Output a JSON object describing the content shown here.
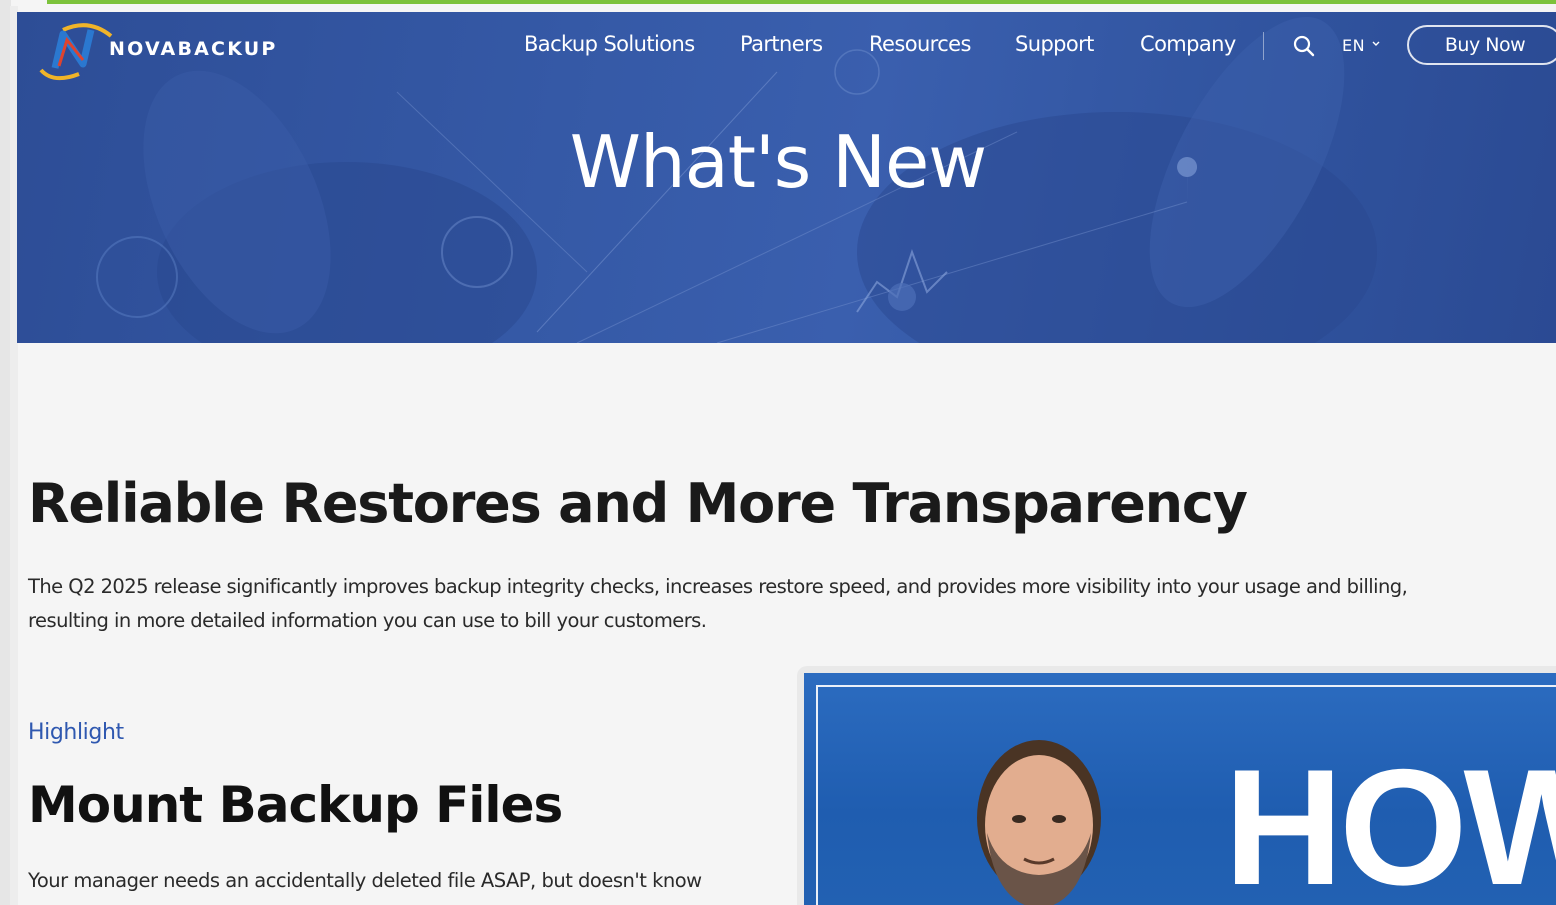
{
  "header": {
    "logo_text": "NOVABACKUP",
    "nav": [
      {
        "label": "Backup Solutions"
      },
      {
        "label": "Partners"
      },
      {
        "label": "Resources"
      },
      {
        "label": "Support"
      },
      {
        "label": "Company"
      }
    ],
    "search_icon": "search-icon",
    "language": "EN",
    "buy_now_label": "Buy Now"
  },
  "hero": {
    "title": "What's New"
  },
  "main": {
    "heading": "Reliable Restores and More Transparency",
    "intro_line1": "The Q2 2025 release significantly improves backup integrity checks, increases restore speed, and provides more visibility into your usage and billing,",
    "intro_line2": "resulting in more detailed information you can use to bill your customers.",
    "highlight_label": "Highlight",
    "section_heading": "Mount Backup Files",
    "section_body": "Your manager needs an accidentally deleted file ASAP, but doesn't know"
  },
  "video": {
    "overlay_text": "HOW"
  },
  "colors": {
    "accent_green": "#7cc23b",
    "hero_blue": "#3559a6",
    "link_blue": "#2f58b0",
    "video_blue": "#2c6cc0"
  }
}
